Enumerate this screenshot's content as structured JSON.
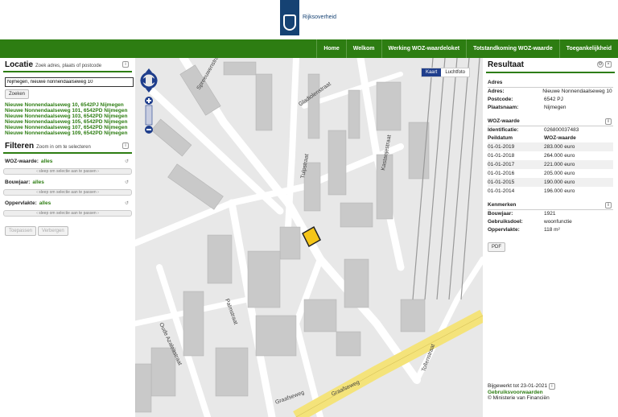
{
  "header": {
    "logo_text": "Rijksoverheid",
    "nav": [
      "Home",
      "Welkom",
      "Werking WOZ-waardeloket",
      "Totstandkoming WOZ-waarde",
      "Toegankelijkheid"
    ]
  },
  "left": {
    "locatie_title": "Locatie",
    "locatie_hint": "Zoek adres, plaats of postcode",
    "search_value": "Nijmegen, nieuwe nonnendaalseweg 10",
    "search_button": "Zoeken",
    "results": [
      "Nieuwe Nonnendaalseweg 10, 6542PJ Nijmegen",
      "Nieuwe Nonnendaalseweg 101, 6542PD Nijmegen",
      "Nieuwe Nonnendaalseweg 103, 6542PD Nijmegen",
      "Nieuwe Nonnendaalseweg 105, 6542PD Nijmegen",
      "Nieuwe Nonnendaalseweg 107, 6542PD Nijmegen",
      "Nieuwe Nonnendaalseweg 109, 6542PD Nijmegen"
    ],
    "filter_title": "Filteren",
    "filter_hint": "Zoom in om te selecteren",
    "filters": [
      {
        "label": "WOZ-waarde:",
        "value": "alles"
      },
      {
        "label": "Bouwjaar:",
        "value": "alles"
      },
      {
        "label": "Oppervlakte:",
        "value": "alles"
      }
    ],
    "slider_text": "‹ sleep om selectie aan te passen ›",
    "apply_button": "Toepassen",
    "hide_button": "Verbergen"
  },
  "map": {
    "toggle": [
      "Kaart",
      "Luchtfoto"
    ],
    "active": "Kaart",
    "streets": [
      "Spreeuwenstraat",
      "Gladiolenstraat",
      "Tulpstraat",
      "Kastanjestraat",
      "Palmstraat",
      "Oude Azaleastraat",
      "Graafseweg",
      "Tollenstraat",
      "Graafseweg"
    ]
  },
  "right": {
    "title": "Resultaat",
    "adres_title": "Adres",
    "adres": [
      {
        "k": "Adres:",
        "v": "Nieuwe Nonnendaalseweg 10"
      },
      {
        "k": "Postcode:",
        "v": "6542 PJ"
      },
      {
        "k": "Plaatsnaam:",
        "v": "Nijmegen"
      }
    ],
    "woz_title": "WOZ-waarde",
    "identificatie_label": "Identificatie:",
    "identificatie_value": "026800037483",
    "peildatum_label": "Peildatum",
    "woz_label": "WOZ-waarde",
    "woz_rows": [
      {
        "d": "01-01-2019",
        "v": "283.000 euro"
      },
      {
        "d": "01-01-2018",
        "v": "264.000 euro"
      },
      {
        "d": "01-01-2017",
        "v": "221.000 euro"
      },
      {
        "d": "01-01-2016",
        "v": "205.000 euro"
      },
      {
        "d": "01-01-2015",
        "v": "190.000 euro"
      },
      {
        "d": "01-01-2014",
        "v": "196.000 euro"
      }
    ],
    "kenmerken_title": "Kenmerken",
    "kenmerken": [
      {
        "k": "Bouwjaar:",
        "v": "1921"
      },
      {
        "k": "Gebruiksdoel:",
        "v": "woonfunctie"
      },
      {
        "k": "Oppervlakte:",
        "v": "118 m²"
      }
    ],
    "pdf_button": "PDF",
    "footer_updated": "Bijgewerkt tot 23-01-2021",
    "footer_link": "Gebruiksvoorwaarden",
    "footer_copy": "© Ministerie van Financiën"
  }
}
